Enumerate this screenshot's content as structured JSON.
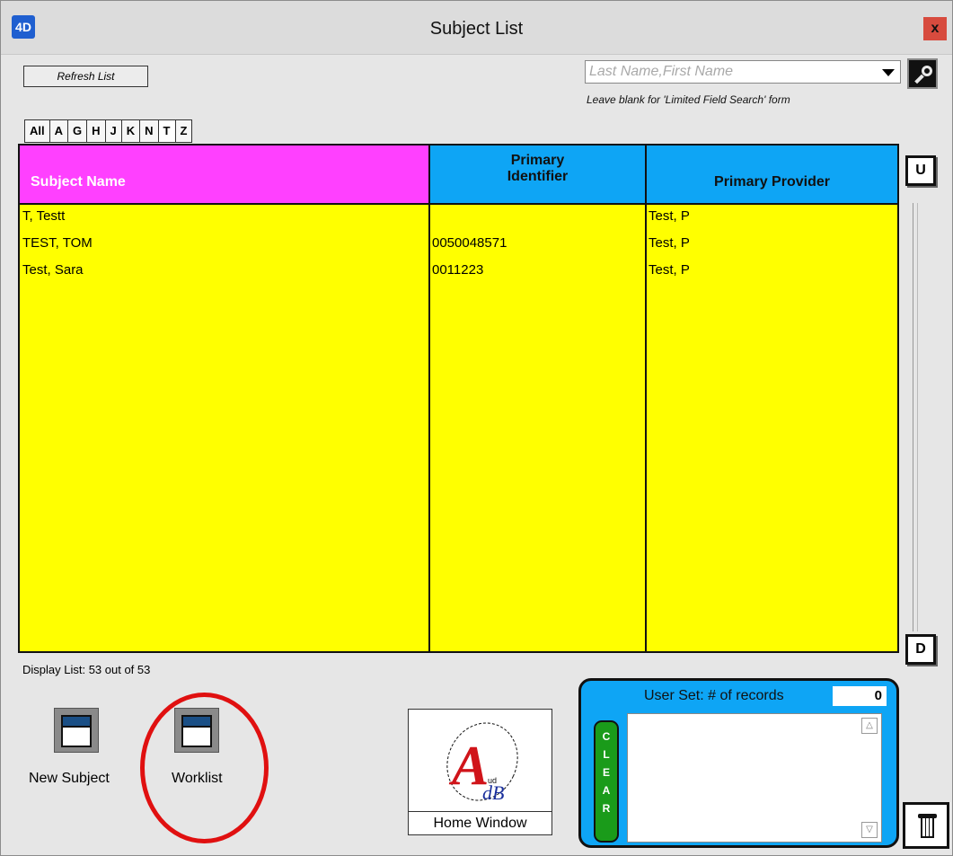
{
  "window": {
    "title": "Subject List",
    "app_icon": "4D",
    "close_label": "x"
  },
  "toolbar": {
    "refresh_label": "Refresh List",
    "search_placeholder": "Last Name,First Name",
    "search_value": "",
    "search_hint": "Leave blank for 'Limited Field Search' form",
    "search_icon": "magnifier-icon"
  },
  "alpha_tabs": [
    {
      "label": "All",
      "active": false
    },
    {
      "label": "A",
      "active": false
    },
    {
      "label": "G",
      "active": false
    },
    {
      "label": "H",
      "active": false
    },
    {
      "label": "J",
      "active": false
    },
    {
      "label": "K",
      "active": false
    },
    {
      "label": "N",
      "active": false
    },
    {
      "label": "T",
      "active": true
    },
    {
      "label": "Z",
      "active": false
    }
  ],
  "table": {
    "columns": [
      "Subject Name",
      "Primary Identifier",
      "Primary Provider"
    ],
    "ident_header_line1": "Primary",
    "ident_header_line2": "Identifier",
    "rows": [
      {
        "name": "T, Testt",
        "identifier": "",
        "provider": "Test, P"
      },
      {
        "name": "TEST, TOM",
        "identifier": "0050048571",
        "provider": "Test, P"
      },
      {
        "name": "Test, Sara",
        "identifier": "0011223",
        "provider": "Test, P"
      }
    ],
    "colors": {
      "name_header": "#ff40ff",
      "other_header": "#0ea5f5",
      "body": "#ffff00"
    }
  },
  "scroll": {
    "up_label": "U",
    "down_label": "D"
  },
  "status": {
    "display_list": "Display List: 53 out of 53"
  },
  "actions": {
    "new_subject_label": "New Subject",
    "worklist_label": "Worklist",
    "home_label": "Home Window"
  },
  "userset": {
    "label": "User Set:  # of records",
    "count": "0",
    "clear_letters": [
      "C",
      "L",
      "E",
      "A",
      "R"
    ],
    "list_items": []
  },
  "icons": {
    "trash": "trash-icon",
    "new_subject": "card-icon",
    "worklist": "card-icon",
    "home_logo": "audb-logo"
  }
}
